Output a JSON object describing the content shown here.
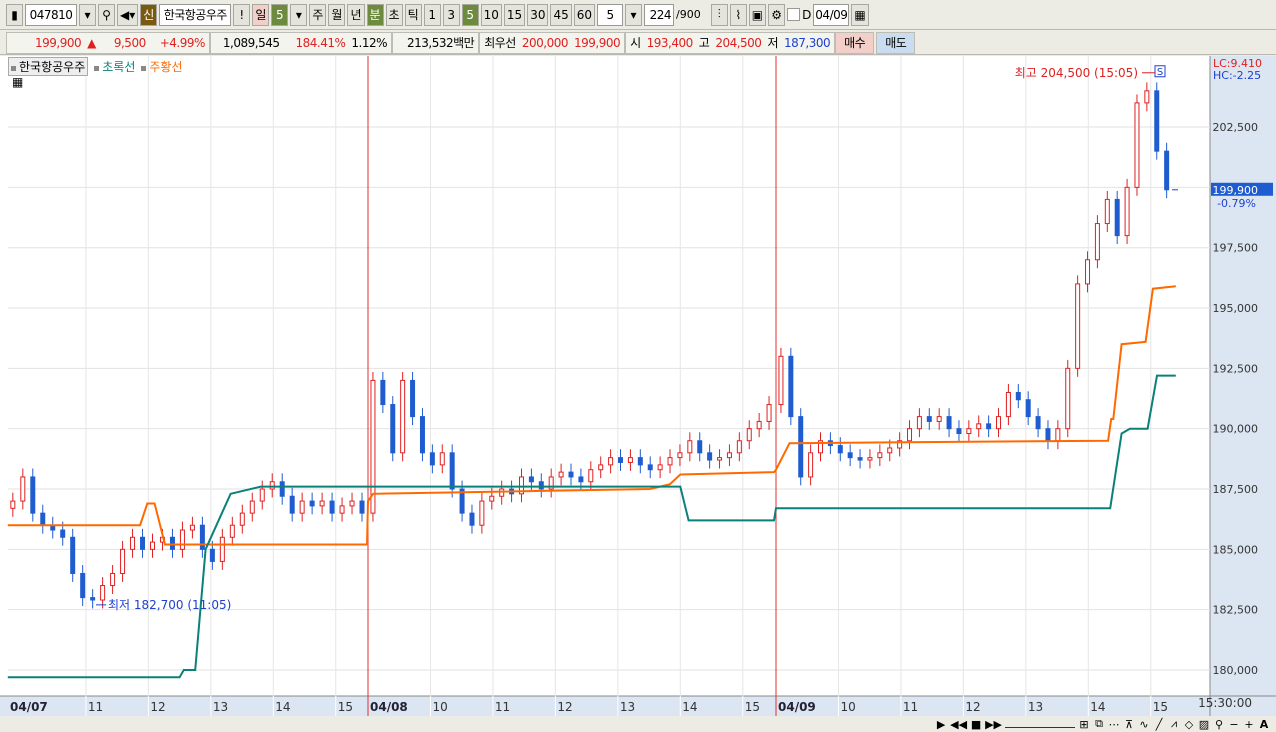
{
  "toolbar": {
    "code": "047810",
    "stock_name": "한국항공우주",
    "new_badge": "신",
    "alert": "!",
    "period_day": "일",
    "period_day_value": "5",
    "periods": [
      "주",
      "월",
      "년",
      "분",
      "초",
      "틱"
    ],
    "minute_options": [
      "1",
      "3",
      "5",
      "10",
      "15",
      "30",
      "45",
      "60"
    ],
    "selected_minute": "5",
    "interval_value": "5",
    "count": "224",
    "count_max": "/900",
    "checkbox_label": "D",
    "date": "04/09"
  },
  "quote": {
    "price": "199,900",
    "arrow": "▲",
    "change": "9,500",
    "change_pct": "+4.99%",
    "volume": "1,089,545",
    "volume_ratio": "184.41%",
    "turnover": "1.12%",
    "amount": "213,532백만",
    "best_label": "최우선",
    "best_ask": "200,000",
    "best_bid": "199,900",
    "open_label": "시",
    "open": "193,400",
    "high_label": "고",
    "high": "204,500",
    "low_label": "저",
    "low": "187,300",
    "buy": "매수",
    "sell": "매도"
  },
  "legend": {
    "main": "한국항공우주",
    "green_line": "초록선",
    "orange_line": "주황선"
  },
  "colors": {
    "up": "#e02020",
    "down": "#1e5cd0",
    "orange": "#ff6a00",
    "teal": "#0a8078",
    "dayline": "#e03030"
  },
  "chart_data": {
    "type": "candlestick",
    "y_ticks": [
      180000,
      182500,
      185000,
      187500,
      190000,
      192500,
      195000,
      197500,
      200000,
      202500
    ],
    "y_tick_labels": [
      "180,000",
      "182,500",
      "185,000",
      "187,500",
      "190,000",
      "192,500",
      "195,000",
      "197,500",
      "200,000",
      "202,500"
    ],
    "ylim": [
      179300,
      205800
    ],
    "days": [
      {
        "label": "04/07",
        "hours": [
          "11",
          "12",
          "13",
          "14",
          "15"
        ],
        "start_min": 45,
        "end_min": 390,
        "closes": [
          187000,
          188000,
          186500,
          186000,
          185800,
          185500,
          184000,
          183000,
          182900,
          183500,
          184000,
          185000,
          185500,
          185000,
          185300,
          185500,
          185000,
          185800,
          186000,
          185000,
          184500,
          185500,
          186000,
          186500,
          187000,
          187500,
          187800,
          187200,
          186500,
          187000,
          186800,
          187000,
          186500,
          186800,
          187000,
          186500
        ]
      },
      {
        "label": "04/08",
        "hours": [
          "10",
          "11",
          "12",
          "13",
          "14",
          "15"
        ],
        "start_min": 0,
        "end_min": 390,
        "closes": [
          192000,
          191000,
          189000,
          192000,
          190500,
          189000,
          188500,
          189000,
          187500,
          186500,
          186000,
          187000,
          187200,
          187500,
          187300,
          188000,
          187800,
          187500,
          188000,
          188200,
          188000,
          187800,
          188300,
          188500,
          188800,
          188600,
          188800,
          188500,
          188300,
          188500,
          188800,
          189000,
          189500,
          189000,
          188700,
          188800,
          189000,
          189500,
          190000,
          190300,
          191000
        ]
      },
      {
        "label": "04/09",
        "hours": [
          "10",
          "11",
          "12",
          "13",
          "14",
          "15"
        ],
        "start_min": 0,
        "end_min": 380,
        "closes": [
          193000,
          190500,
          188000,
          189000,
          189500,
          189300,
          189000,
          188800,
          188700,
          188800,
          189000,
          189200,
          189500,
          190000,
          190500,
          190300,
          190500,
          190000,
          189800,
          190000,
          190200,
          190000,
          190500,
          191500,
          191200,
          190500,
          190000,
          189500,
          190000,
          192500,
          196000,
          197000,
          198500,
          199500,
          198000,
          200000,
          203500,
          204000,
          201500,
          199900
        ]
      }
    ],
    "series": [
      {
        "name": "주황선",
        "points": [
          [
            0,
            45,
            186000
          ],
          [
            0,
            172,
            186000
          ],
          [
            0,
            179,
            186900
          ],
          [
            0,
            186,
            186900
          ],
          [
            0,
            196,
            185200
          ],
          [
            0,
            390,
            185200
          ],
          [
            1,
            0,
            187000
          ],
          [
            1,
            5,
            187300
          ],
          [
            1,
            271,
            187500
          ],
          [
            1,
            290,
            187700
          ],
          [
            1,
            300,
            188100
          ],
          [
            1,
            390,
            188200
          ],
          [
            2,
            0,
            188300
          ],
          [
            2,
            13,
            189400
          ],
          [
            2,
            319,
            189500
          ],
          [
            2,
            322,
            190400
          ],
          [
            2,
            324,
            190400
          ],
          [
            2,
            332,
            193500
          ],
          [
            2,
            355,
            193600
          ],
          [
            2,
            362,
            195800
          ],
          [
            2,
            384,
            195900
          ]
        ]
      },
      {
        "name": "초록선",
        "points": [
          [
            0,
            45,
            179700
          ],
          [
            0,
            210,
            179700
          ],
          [
            0,
            214,
            180000
          ],
          [
            0,
            225,
            180000
          ],
          [
            0,
            235,
            185000
          ],
          [
            0,
            259,
            187300
          ],
          [
            0,
            288,
            187600
          ],
          [
            1,
            0,
            187600
          ],
          [
            1,
            300,
            187600
          ],
          [
            1,
            308,
            186200
          ],
          [
            1,
            390,
            186200
          ],
          [
            2,
            0,
            186700
          ],
          [
            2,
            321,
            186700
          ],
          [
            2,
            332,
            189800
          ],
          [
            2,
            340,
            190000
          ],
          [
            2,
            357,
            190000
          ],
          [
            2,
            366,
            192200
          ],
          [
            2,
            384,
            192200
          ]
        ]
      }
    ],
    "annotations": {
      "high": "최고 204,500 (15:05)",
      "low": "최저 182,700 (11:05)",
      "last_price": "199,900",
      "last_pct": "-0.79%",
      "lc": "LC:9.410",
      "hc": "HC:-2.25",
      "time_end": "15:30:00",
      "high_marker": "S"
    }
  }
}
